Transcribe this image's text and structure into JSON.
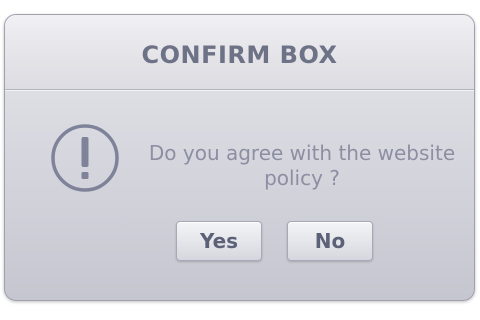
{
  "dialog": {
    "title": "CONFIRM BOX",
    "message": "Do you agree with the website policy ?",
    "icon": "exclamation-circle-icon",
    "buttons": {
      "yes_label": "Yes",
      "no_label": "No"
    }
  },
  "colors": {
    "title_text": "#6e7287",
    "message_text": "#8c8fa2",
    "icon_stroke": "#7f8399",
    "button_text": "#5d6178"
  }
}
